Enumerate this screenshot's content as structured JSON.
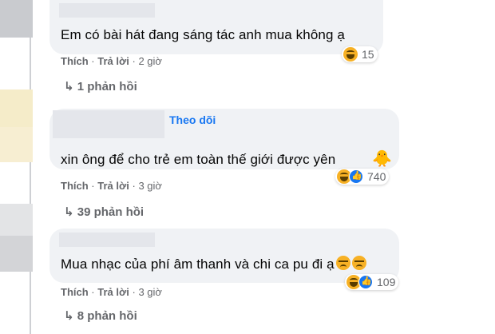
{
  "comments": [
    {
      "text": "Em có bài hát đang sáng tác anh mua không ạ",
      "like_label": "Thích",
      "reply_label": "Trả lời",
      "time": "2 giờ",
      "reaction_count": "15",
      "replies_label": "1 phản hồi"
    },
    {
      "follow_label": "Theo dõi",
      "text": "xin ông để cho trẻ em toàn thế giới được yên",
      "like_label": "Thích",
      "reply_label": "Trả lời",
      "time": "3 giờ",
      "reaction_count": "740",
      "replies_label": "39 phản hồi"
    },
    {
      "text": "Mua nhạc của phí âm thanh và chi ca pu đi ạ",
      "like_label": "Thích",
      "reply_label": "Trả lời",
      "time": "3 giờ",
      "reaction_count": "109",
      "replies_label": "8 phản hồi"
    }
  ],
  "separator": "·",
  "reply_arrow": "↳"
}
